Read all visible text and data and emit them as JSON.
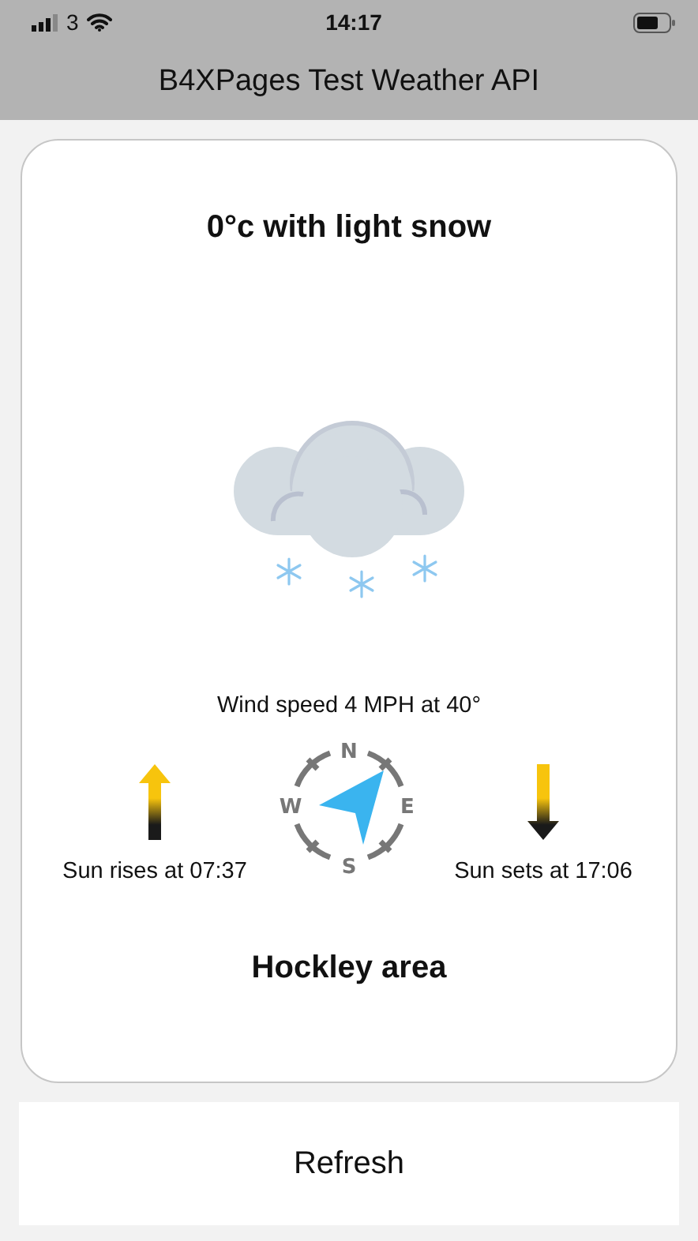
{
  "status_bar": {
    "carrier": "3",
    "time": "14:17"
  },
  "header": {
    "title": "B4XPages Test Weather API"
  },
  "weather": {
    "summary": "0°c with light snow",
    "wind": "Wind speed 4 MPH at 40°",
    "compass": {
      "north": "N",
      "east": "E",
      "south": "S",
      "west": "W"
    },
    "sunrise": "Sun rises at 07:37",
    "sunset": "Sun sets at 17:06",
    "area": "Hockley area"
  },
  "buttons": [
    {
      "label": "Refresh"
    }
  ]
}
